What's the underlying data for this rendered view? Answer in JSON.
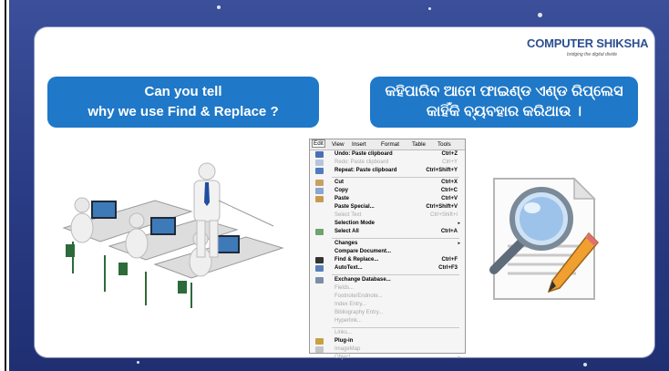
{
  "brand": {
    "name_part1": "COMPUTER",
    "name_part2": "SHIKSHA",
    "tagline": "bridging the digital divide"
  },
  "banner_left": {
    "line1": "Can you tell",
    "line2": "why we use Find & Replace ?"
  },
  "banner_right": {
    "line1": "କହିପାରିବ ଆମେ ଫାଇଣ୍ଡ ଏଣ୍ଡ ରିପ୍ଲେସ",
    "line2": "କାହିଁକି ବ୍ୟବହାର କରିଥାଉ ।"
  },
  "menu": {
    "menubar": [
      "Edit",
      "View",
      "Insert",
      "Format",
      "Table",
      "Tools"
    ],
    "items": [
      {
        "label": "Undo: Paste clipboard",
        "shortcut": "Ctrl+Z",
        "enabled": true,
        "icon": "undo-icon"
      },
      {
        "label": "Redo: Paste clipboard",
        "shortcut": "Ctrl+Y",
        "enabled": false,
        "icon": "redo-icon"
      },
      {
        "label": "Repeat: Paste clipboard",
        "shortcut": "Ctrl+Shift+Y",
        "enabled": true,
        "icon": "repeat-icon"
      },
      {
        "label": "Cut",
        "shortcut": "Ctrl+X",
        "enabled": true,
        "icon": "scissors-icon"
      },
      {
        "label": "Copy",
        "shortcut": "Ctrl+C",
        "enabled": true,
        "icon": "copy-icon"
      },
      {
        "label": "Paste",
        "shortcut": "Ctrl+V",
        "enabled": true,
        "icon": "paste-icon"
      },
      {
        "label": "Paste Special...",
        "shortcut": "Ctrl+Shift+V",
        "enabled": true,
        "icon": ""
      },
      {
        "label": "Select Text",
        "shortcut": "Ctrl+Shift+I",
        "enabled": false,
        "icon": ""
      },
      {
        "label": "Selection Mode",
        "shortcut": "",
        "enabled": true,
        "icon": "",
        "submenu": true
      },
      {
        "label": "Select All",
        "shortcut": "Ctrl+A",
        "enabled": true,
        "icon": "select-all-icon"
      },
      {
        "label": "Changes",
        "shortcut": "",
        "enabled": true,
        "icon": "",
        "submenu": true
      },
      {
        "label": "Compare Document...",
        "shortcut": "",
        "enabled": true,
        "icon": ""
      },
      {
        "label": "Find & Replace...",
        "shortcut": "Ctrl+F",
        "enabled": true,
        "icon": "binoculars-icon"
      },
      {
        "label": "AutoText...",
        "shortcut": "Ctrl+F3",
        "enabled": true,
        "icon": "autotext-icon"
      },
      {
        "label": "Exchange Database...",
        "shortcut": "",
        "enabled": true,
        "icon": "database-icon"
      },
      {
        "label": "Fields...",
        "shortcut": "",
        "enabled": false,
        "icon": ""
      },
      {
        "label": "Footnote/Endnote...",
        "shortcut": "",
        "enabled": false,
        "icon": ""
      },
      {
        "label": "Index Entry...",
        "shortcut": "",
        "enabled": false,
        "icon": ""
      },
      {
        "label": "Bibliography Entry...",
        "shortcut": "",
        "enabled": false,
        "icon": ""
      },
      {
        "label": "Hyperlink...",
        "shortcut": "",
        "enabled": false,
        "icon": ""
      },
      {
        "label": "Links...",
        "shortcut": "",
        "enabled": false,
        "icon": ""
      },
      {
        "label": "Plug-in",
        "shortcut": "",
        "enabled": true,
        "icon": "plugin-icon"
      },
      {
        "label": "ImageMap",
        "shortcut": "",
        "enabled": false,
        "icon": "imagemap-icon"
      },
      {
        "label": "Object",
        "shortcut": "",
        "enabled": false,
        "icon": "",
        "submenu": true
      }
    ]
  },
  "colors": {
    "banner": "#1f78c8",
    "background": "#2a3c85",
    "brand_blue": "#2c4f8f",
    "brand_red": "#c0392b"
  }
}
